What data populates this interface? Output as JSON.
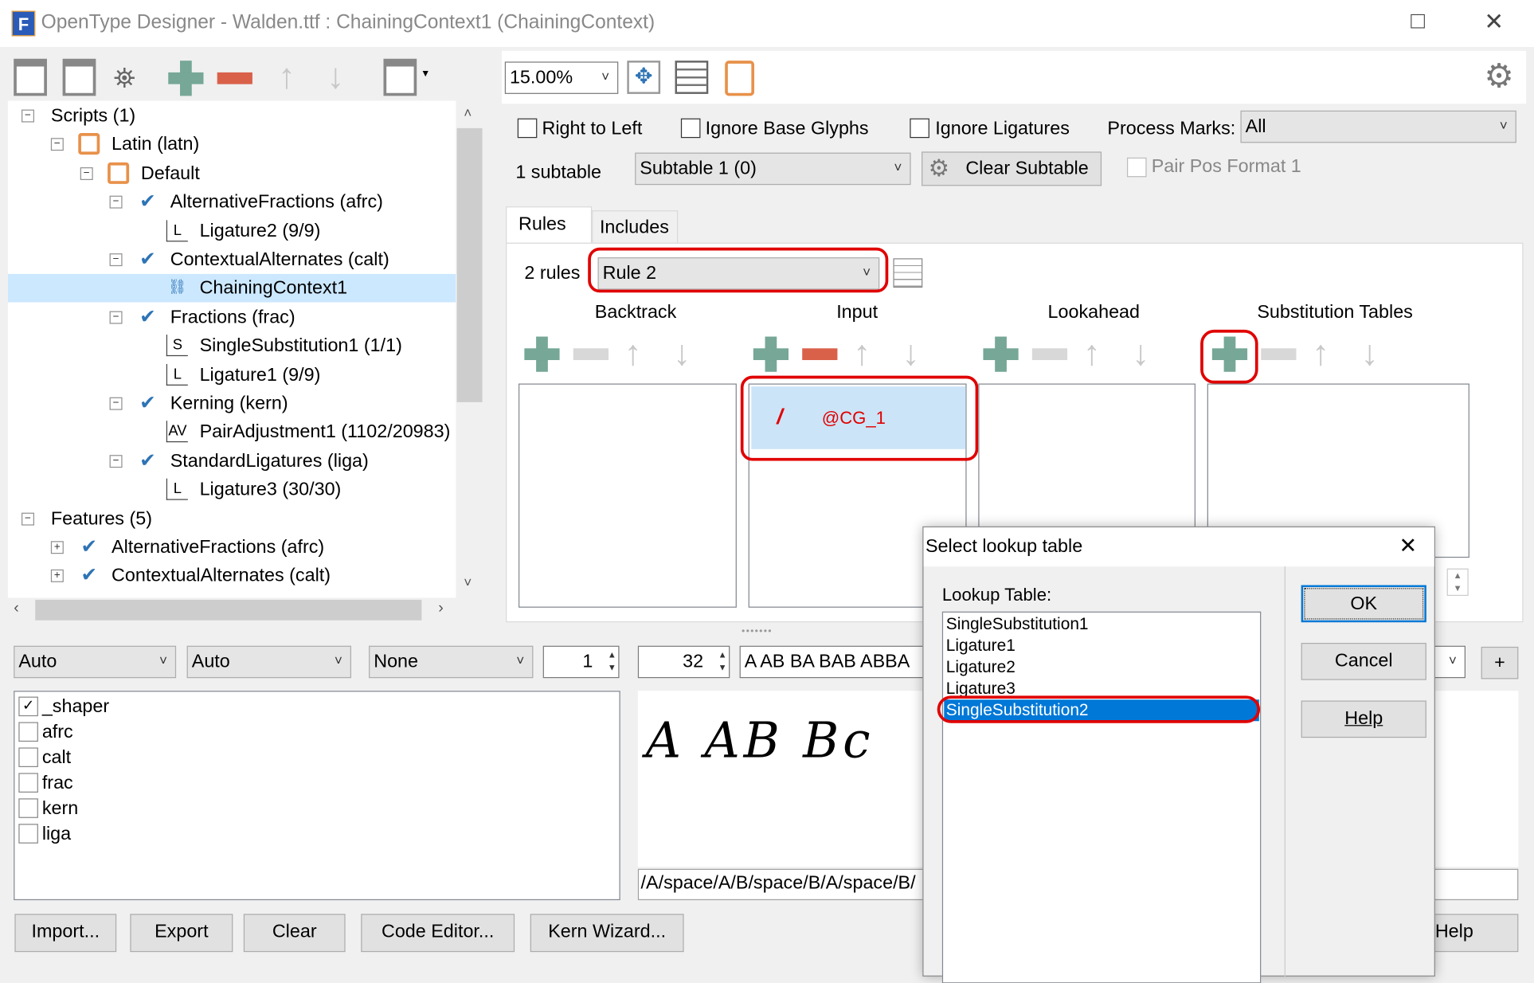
{
  "window": {
    "title": "OpenType Designer - Walden.ttf : ChainingContext1 (ChainingContext)",
    "maximize_icon": "□",
    "close_icon": "✕"
  },
  "left_toolbar": {
    "icons": [
      "import-lookup-icon",
      "preview-lookup-icon",
      "find-icon",
      "add-icon",
      "remove-icon",
      "move-up-icon",
      "move-down-icon",
      "lookup-menu-icon"
    ]
  },
  "tree": {
    "items": [
      {
        "label": "Scripts (1)",
        "level": 0,
        "expander": "-"
      },
      {
        "label": "Latin (latn)",
        "level": 1,
        "expander": "-",
        "icon": "script-icon"
      },
      {
        "label": "Default",
        "level": 2,
        "expander": "-",
        "icon": "language-icon"
      },
      {
        "label": "AlternativeFractions (afrc)",
        "level": 3,
        "expander": "-",
        "icon": "feature-check-icon"
      },
      {
        "label": "Ligature2 (9/9)",
        "level": 4,
        "icon": "L"
      },
      {
        "label": "ContextualAlternates (calt)",
        "level": 3,
        "expander": "-",
        "icon": "feature-check-icon"
      },
      {
        "label": "ChainingContext1",
        "level": 4,
        "icon": "chain-icon",
        "selected": true
      },
      {
        "label": "Fractions (frac)",
        "level": 3,
        "expander": "-",
        "icon": "feature-check-icon"
      },
      {
        "label": "SingleSubstitution1 (1/1)",
        "level": 4,
        "icon": "S"
      },
      {
        "label": "Ligature1 (9/9)",
        "level": 4,
        "icon": "L"
      },
      {
        "label": "Kerning (kern)",
        "level": 3,
        "expander": "-",
        "icon": "feature-check-icon"
      },
      {
        "label": "PairAdjustment1 (1102/20983)",
        "level": 4,
        "icon": "AV"
      },
      {
        "label": "StandardLigatures (liga)",
        "level": 3,
        "expander": "-",
        "icon": "feature-check-icon"
      },
      {
        "label": "Ligature3 (30/30)",
        "level": 4,
        "icon": "L"
      },
      {
        "label": "Features (5)",
        "level": 0,
        "expander": "-"
      },
      {
        "label": "AlternativeFractions (afrc)",
        "level": 1,
        "expander": "+",
        "icon": "feature-check-icon"
      },
      {
        "label": "ContextualAlternates (calt)",
        "level": 1,
        "expander": "+",
        "icon": "feature-check-icon"
      }
    ]
  },
  "right_toolbar": {
    "zoom": "15.00%",
    "icons": [
      "fit-icon",
      "grid-icon",
      "edit-icon",
      "settings-gear-icon"
    ]
  },
  "options": {
    "right_to_left": "Right to Left",
    "ignore_base": "Ignore Base Glyphs",
    "ignore_ligatures": "Ignore Ligatures",
    "process_marks_label": "Process Marks:",
    "process_marks_value": "All",
    "subtable_count": "1 subtable",
    "subtable_value": "Subtable 1 (0)",
    "clear_subtable": "Clear Subtable",
    "pair_pos": "Pair Pos Format 1"
  },
  "tabs": [
    {
      "label": "Rules",
      "active": true
    },
    {
      "label": "Includes"
    }
  ],
  "rules": {
    "count": "2 rules",
    "selected": "Rule 2",
    "columns": [
      "Backtrack",
      "Input",
      "Lookahead",
      "Substitution Tables"
    ],
    "input_items": [
      "@CG_1"
    ]
  },
  "bottom": {
    "combo1": "Auto",
    "combo2": "Auto",
    "combo3": "None",
    "spin1": "1",
    "spin2": "32",
    "sample_text": "A AB BA BAB ABBA",
    "add": "+",
    "features": [
      {
        "label": "_shaper",
        "checked": true
      },
      {
        "label": "afrc",
        "checked": false
      },
      {
        "label": "calt",
        "checked": false
      },
      {
        "label": "frac",
        "checked": false
      },
      {
        "label": "kern",
        "checked": false
      },
      {
        "label": "liga",
        "checked": false
      }
    ],
    "preview_text": "A AB Bc",
    "glyph_string": "/A/space/A/B/space/B/A/space/B/",
    "buttons": [
      "Import...",
      "Export",
      "Clear",
      "Code Editor...",
      "Kern Wizard..."
    ],
    "help": "Help"
  },
  "dialog": {
    "title": "Select lookup table",
    "close": "✕",
    "label": "Lookup Table:",
    "items": [
      "SingleSubstitution1",
      "Ligature1",
      "Ligature2",
      "Ligature3",
      "SingleSubstitution2"
    ],
    "selected": "SingleSubstitution2",
    "ok": "OK",
    "cancel": "Cancel",
    "help": "Help"
  },
  "colors": {
    "add": "#76a797",
    "remove": "#d9614a",
    "selection": "#0078d7",
    "highlight": "#cce4f7",
    "annotation": "#e00000"
  }
}
